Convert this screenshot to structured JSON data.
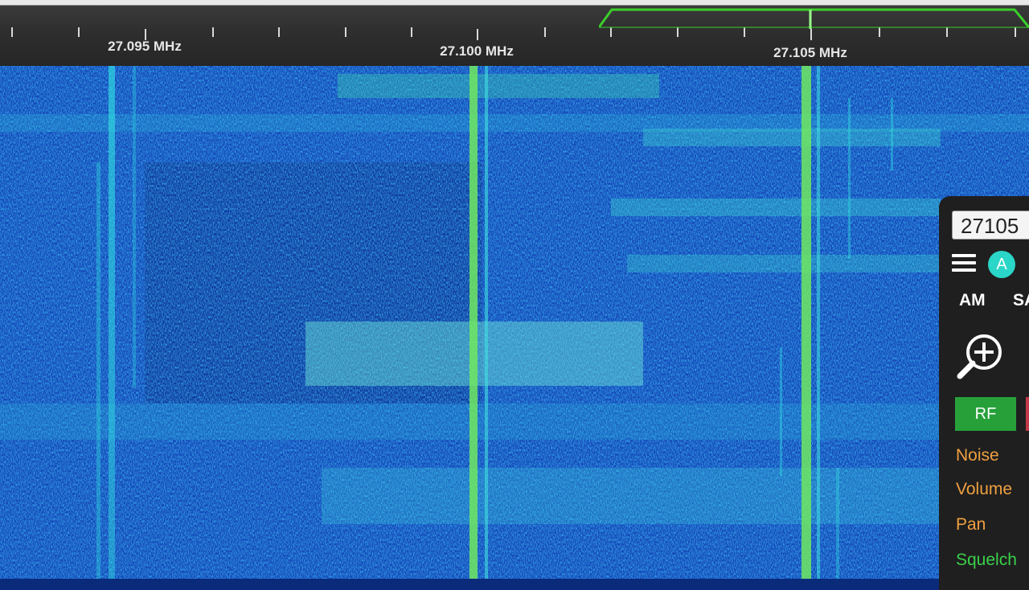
{
  "scale": {
    "labels": [
      "27.095 MHz",
      "27.100 MHz",
      "27.105 MHz"
    ]
  },
  "panel": {
    "frequency": "27105",
    "auto_label": "A",
    "modes": [
      "AM",
      "SA"
    ],
    "rf_label": "RF",
    "sliders": [
      {
        "label": "Noise",
        "color": "#f0a040"
      },
      {
        "label": "Volume",
        "color": "#f0a040"
      },
      {
        "label": "Pan",
        "color": "#f0a040"
      },
      {
        "label": "Squelch",
        "color": "#3ad04a"
      }
    ]
  },
  "colors": {
    "waterfall_background": "#1446b8",
    "signal": "#30d8e0",
    "passband": "#3ad02a",
    "rf_active": "#27a03a"
  }
}
